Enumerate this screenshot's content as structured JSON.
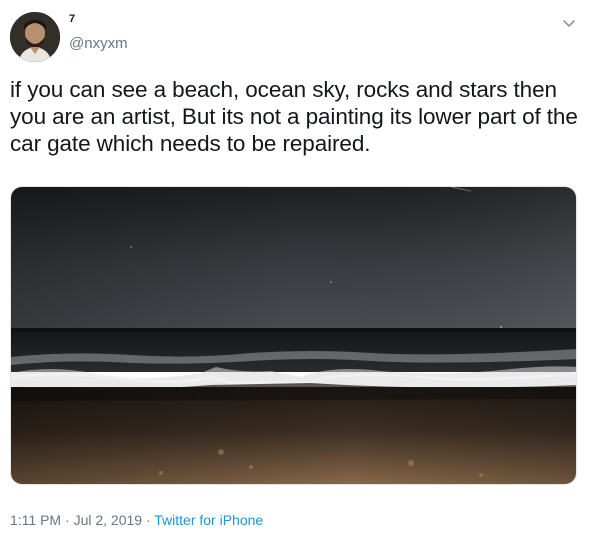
{
  "author": {
    "display_name": "7",
    "handle": "@nxyxm"
  },
  "tweet": {
    "text": "if you can see a beach, ocean sky, rocks and stars then you are an artist, But its not a painting its lower part of the car gate which needs to be repaired."
  },
  "meta": {
    "time": "1:11 PM",
    "separator1": " · ",
    "date": "Jul 2, 2019",
    "separator2": " · ",
    "source": "Twitter for iPhone"
  },
  "icons": {
    "menu": "chevron-down-icon"
  },
  "colors": {
    "text": "#14171a",
    "secondary": "#657786",
    "link": "#1b95e0"
  }
}
